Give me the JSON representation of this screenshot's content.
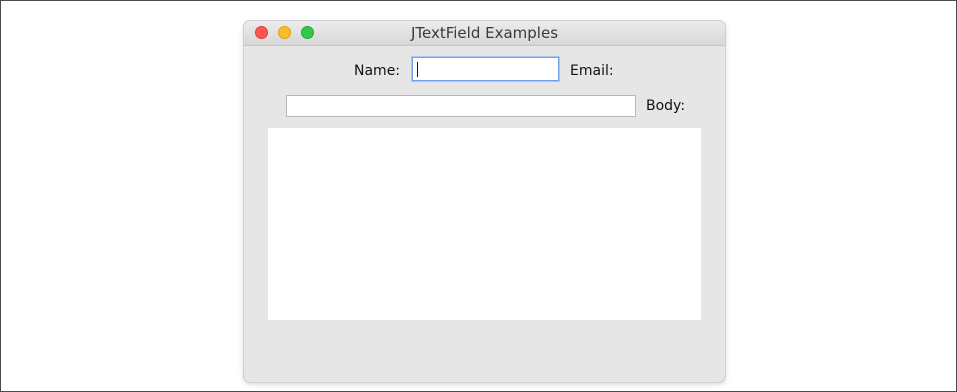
{
  "window": {
    "title": "JTextField Examples",
    "controls": {
      "close_color": "#fc5753",
      "minimize_color": "#fdbc2e",
      "zoom_color": "#33c748"
    }
  },
  "form": {
    "name_label": "Name:",
    "name_value": "",
    "email_label": "Email:",
    "email_value": "",
    "body_label": "Body:",
    "body_value": ""
  },
  "colors": {
    "focus_ring": "#6fa0e8",
    "window_background": "#e6e6e6"
  }
}
